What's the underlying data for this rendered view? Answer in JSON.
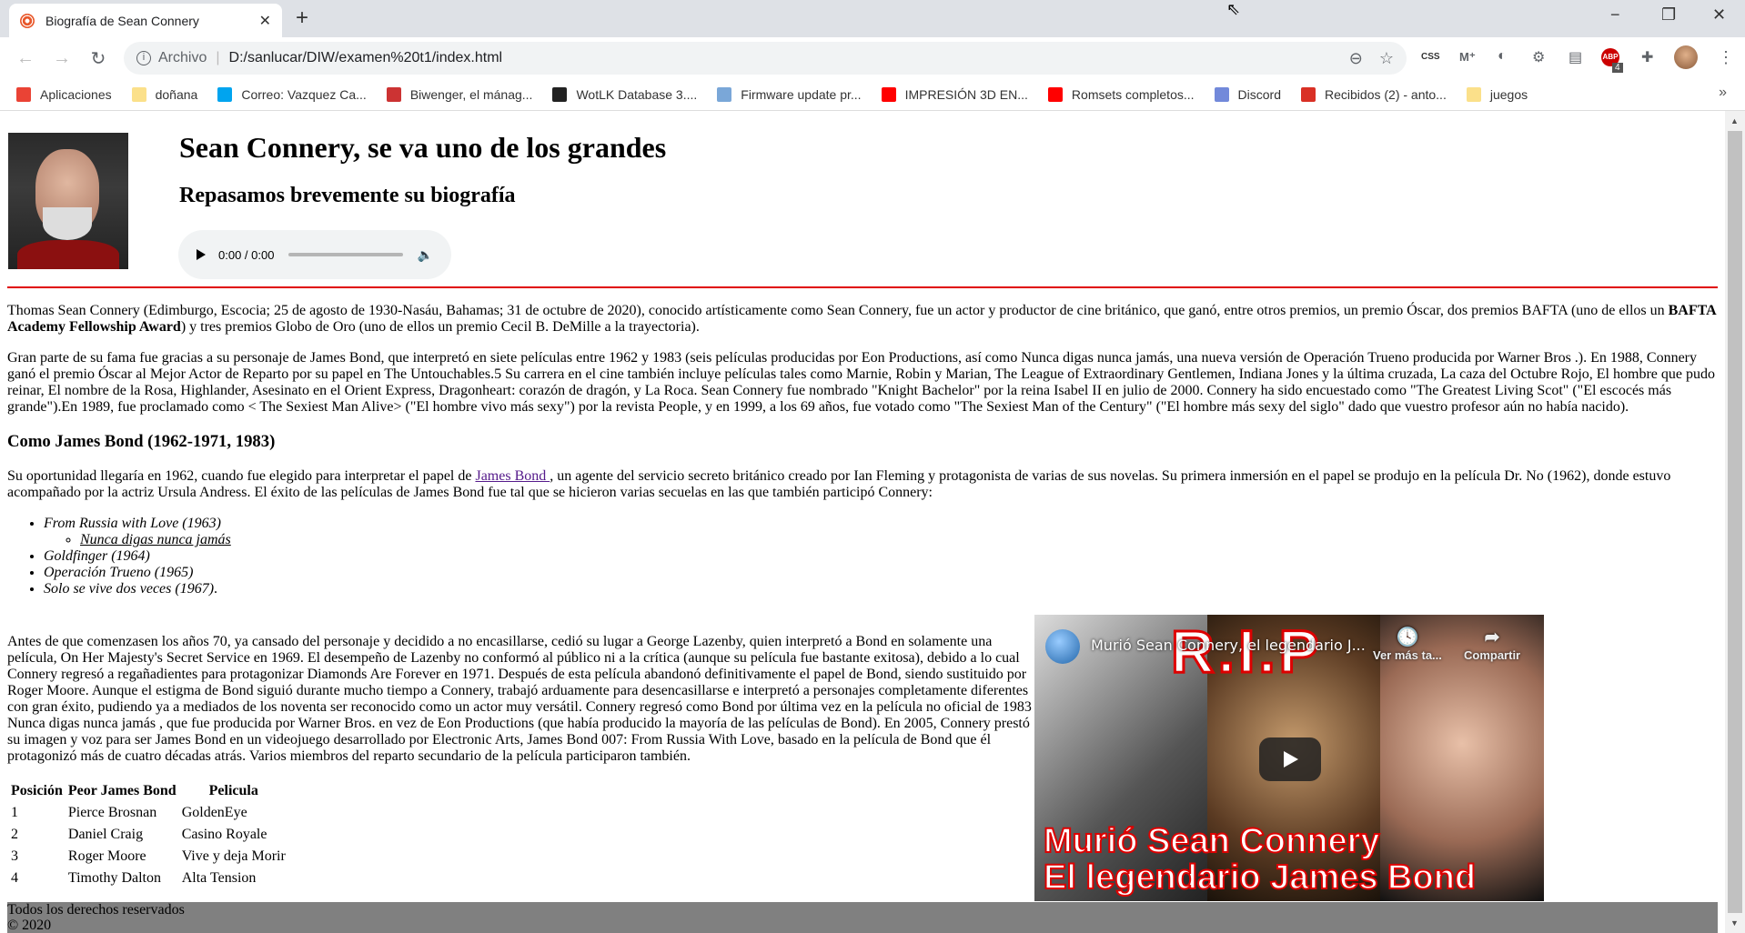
{
  "browser": {
    "tab_title": "Biografía de Sean Connery",
    "scheme_label": "Archivo",
    "url": "D:/sanlucar/DIW/examen%20t1/index.html",
    "extension_badge": "4",
    "extension_css_label": "CSS",
    "extension_abp_label": "ABP",
    "bookmarks": [
      {
        "label": "Aplicaciones",
        "icon": "apps-grid-icon",
        "color": "#ea4335"
      },
      {
        "label": "doñana",
        "icon": "folder-icon",
        "color": "#fbe08a"
      },
      {
        "label": "Correo: Vazquez Ca...",
        "icon": "microsoft-icon",
        "color": "#00a4ef"
      },
      {
        "label": "Biwenger, el mánag...",
        "icon": "biwenger-icon",
        "color": "#c33"
      },
      {
        "label": "WotLK Database 3....",
        "icon": "wotlk-icon",
        "color": "#222"
      },
      {
        "label": "Firmware update pr...",
        "icon": "gt-icon",
        "color": "#7aa7d8"
      },
      {
        "label": "IMPRESIÓN 3D EN...",
        "icon": "youtube-icon",
        "color": "#ff0000"
      },
      {
        "label": "Romsets completos...",
        "icon": "youtube-icon",
        "color": "#ff0000"
      },
      {
        "label": "Discord",
        "icon": "discord-icon",
        "color": "#7289da"
      },
      {
        "label": "Recibidos (2) - anto...",
        "icon": "gmail-icon",
        "color": "#d93025"
      },
      {
        "label": "juegos",
        "icon": "folder-icon",
        "color": "#fbe08a"
      }
    ]
  },
  "header": {
    "title": "Sean Connery, se va uno de los grandes",
    "subtitle": "Repasamos brevemente su biografía",
    "audio_time": "0:00 / 0:00"
  },
  "bio": {
    "p1_a": "Thomas Sean Connery (Edimburgo, Escocia; 25 de agosto de 1930-Nasáu, Bahamas; 31 de octubre de 2020), conocido artísticamente como Sean Connery, fue un actor y productor de cine británico, que ganó, entre otros premios, un premio Óscar, dos premios BAFTA (uno de ellos un ",
    "p1_bold": "BAFTA Academy Fellowship Award",
    "p1_b": ") y tres premios Globo de Oro (uno de ellos un premio Cecil B. DeMille a la trayectoria).",
    "p2": "Gran parte de su fama fue gracias a su personaje de James Bond, que interpretó en siete películas entre 1962 y 1983 (seis películas producidas por Eon Productions, así como Nunca digas nunca jamás, una nueva versión de Operación Trueno producida por Warner Bros .). En 1988, Connery ganó el premio Óscar al Mejor Actor de Reparto por su papel en The Untouchables.5 Su carrera en el cine también incluye películas tales como Marnie, Robin y Marian, The League of Extraordinary Gentlemen, Indiana Jones y la última cruzada, La caza del Octubre Rojo, El hombre que pudo reinar, El nombre de la Rosa, Highlander, Asesinato en el Orient Express, Dragonheart: corazón de dragón, y La Roca. Sean Connery fue nombrado \"Knight Bachelor\" por la reina Isabel II en julio de 2000. Connery ha sido encuestado como \"The Greatest Living Scot\" (\"El escocés más grande\").En 1989, fue proclamado como < The Sexiest Man Alive> (\"El hombre vivo más sexy\") por la revista People, y en 1999, a los 69 años, fue votado como \"The Sexiest Man of the Century\" (\"El hombre más sexy del siglo\" dado que vuestro profesor aún no había nacido)."
  },
  "bond": {
    "heading": "Como James Bond (1962-1971, 1983)",
    "p_a": "Su oportunidad llegaría en 1962, cuando fue elegido para interpretar el papel de ",
    "link": "James Bond ",
    "p_b": ", un agente del servicio secreto británico creado por Ian Fleming y protagonista de varias de sus novelas. Su primera inmersión en el papel se produjo en la película Dr. No (1962), donde estuvo acompañado por la actriz Ursula Andress. El éxito de las películas de James Bond fue tal que se hicieron varias secuelas en las que también participó Connery:",
    "films": [
      "From Russia with Love (1963)",
      "Goldfinger (1964)",
      "Operación Trueno (1965)",
      "Solo se vive dos veces (1967)"
    ],
    "films_last_suffix": ".",
    "subfilm": "Nunca digas nunca jamás",
    "p_later": "Antes de que comenzasen los años 70, ya cansado del personaje y decidido a no encasillarse, cedió su lugar a George Lazenby, quien interpretó a Bond en solamente una película, On Her Majesty's Secret Service en 1969. El desempeño de Lazenby no conformó al público ni a la crítica (aunque su película fue bastante exitosa), debido a lo cual Connery regresó a regañadientes para protagonizar Diamonds Are Forever en 1971. Después de esta película abandonó definitivamente el papel de Bond, siendo sustituido por Roger Moore. Aunque el estigma de Bond siguió durante mucho tiempo a Connery, trabajó arduamente para desencasillarse e interpretó a personajes completamente diferentes con gran éxito, pudiendo ya a mediados de los noventa ser reconocido como un actor muy versátil. Connery regresó como Bond por última vez en la película no oficial de 1983 Nunca digas nunca jamás , que fue producida por Warner Bros. en vez de Eon Productions (que había producido la mayoría de las películas de Bond). En 2005, Connery prestó su imagen y voz para ser James Bond en un videojuego desarrollado por Electronic Arts, James Bond 007: From Russia With Love, basado en la película de Bond que él protagonizó más de cuatro décadas atrás. Varios miembros del reparto secundario de la película participaron también."
  },
  "table": {
    "headers": [
      "Posición",
      "Peor James Bond",
      "Pelicula"
    ],
    "rows": [
      [
        "1",
        "Pierce Brosnan",
        "GoldenEye"
      ],
      [
        "2",
        "Daniel Craig",
        "Casino Royale"
      ],
      [
        "3",
        "Roger Moore",
        "Vive y deja Morir"
      ],
      [
        "4",
        "Timothy Dalton",
        "Alta Tension"
      ]
    ]
  },
  "video": {
    "title": "Murió Sean Connery, el legendario J...",
    "watch_later": "Ver más ta...",
    "share": "Compartir",
    "overlay_top": "R.I.P",
    "caption_1": "Murió Sean Connery",
    "caption_2": "El legendario James Bond"
  },
  "footer": {
    "rights": "Todos los derechos reservados",
    "copyright": "© 2020"
  }
}
